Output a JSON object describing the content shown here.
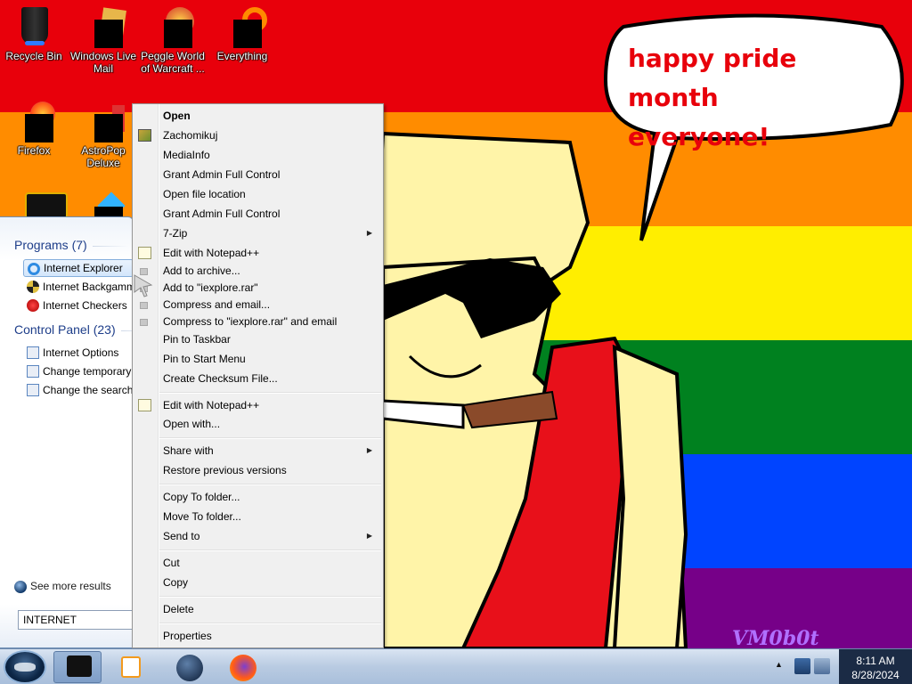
{
  "desktop": {
    "icons": [
      {
        "label": "Recycle Bin"
      },
      {
        "label": "Windows Live Mail"
      },
      {
        "label": "Peggle World of Warcraft ..."
      },
      {
        "label": "Everything"
      },
      {
        "label": "Firefox"
      },
      {
        "label": "AstroPop Deluxe"
      }
    ]
  },
  "wallpaper": {
    "speech_line1": "happy pride month",
    "speech_line2": "everyone!",
    "signature": "VM0b0t",
    "colors": {
      "red": "#e8000b",
      "orange": "#ff8c00",
      "yellow": "#ffee00",
      "green": "#00811f",
      "blue": "#0044ff",
      "purple": "#760088",
      "speech_text": "#e8000b"
    }
  },
  "start_menu": {
    "programs_heading": "Programs (7)",
    "programs": [
      {
        "label": "Internet Explorer",
        "icon": "internet-explorer-icon",
        "selected": true
      },
      {
        "label": "Internet Backgammon",
        "icon": "backgammon-icon"
      },
      {
        "label": "Internet Checkers",
        "icon": "checkers-icon"
      }
    ],
    "control_panel_heading": "Control Panel (23)",
    "control_panel": [
      {
        "label": "Internet Options",
        "icon": "internet-options-icon"
      },
      {
        "label": "Change temporary Internet file settings",
        "icon": "internet-options-icon"
      },
      {
        "label": "Change the search provider in Internet Explorer",
        "icon": "internet-options-icon"
      }
    ],
    "see_more": "See more results",
    "search_value": "INTERNET"
  },
  "context_menu": {
    "items": [
      {
        "label": "Open",
        "bold": true
      },
      {
        "label": "Zachomikuj",
        "icon": "zachomikuj-icon"
      },
      {
        "label": "MediaInfo"
      },
      {
        "label": "Grant Admin Full Control"
      },
      {
        "label": "Open file location"
      },
      {
        "label": "Grant Admin Full Control"
      },
      {
        "label": "7-Zip",
        "submenu": true
      },
      {
        "label": "Edit with Notepad++",
        "icon": "notepad-plus-icon"
      },
      {
        "label": "Add to archive...",
        "icon": "archive-icon"
      },
      {
        "label": "Add to \"iexplore.rar\"",
        "icon": "archive-icon"
      },
      {
        "label": "Compress and email...",
        "icon": "archive-icon"
      },
      {
        "label": "Compress to \"iexplore.rar\" and email",
        "icon": "archive-icon"
      },
      {
        "label": "Pin to Taskbar"
      },
      {
        "label": "Pin to Start Menu"
      },
      {
        "label": "Create Checksum File..."
      },
      {
        "label": "Edit with Notepad++",
        "icon": "notepad-plus-icon"
      },
      {
        "label": "Open with..."
      },
      {
        "label": "Share with",
        "submenu": true
      },
      {
        "label": "Restore previous versions"
      },
      {
        "label": "Copy To folder..."
      },
      {
        "label": "Move To folder..."
      },
      {
        "label": "Send to",
        "submenu": true
      },
      {
        "label": "Cut"
      },
      {
        "label": "Copy"
      },
      {
        "label": "Delete"
      },
      {
        "label": "Properties"
      }
    ]
  },
  "taskbar": {
    "pinned": [
      {
        "icon": "media-player-icon"
      },
      {
        "icon": "media-center-icon"
      },
      {
        "icon": "browser-globe-icon"
      },
      {
        "icon": "firefox-icon"
      }
    ],
    "time": "8:11 AM",
    "date": "8/28/2024"
  }
}
